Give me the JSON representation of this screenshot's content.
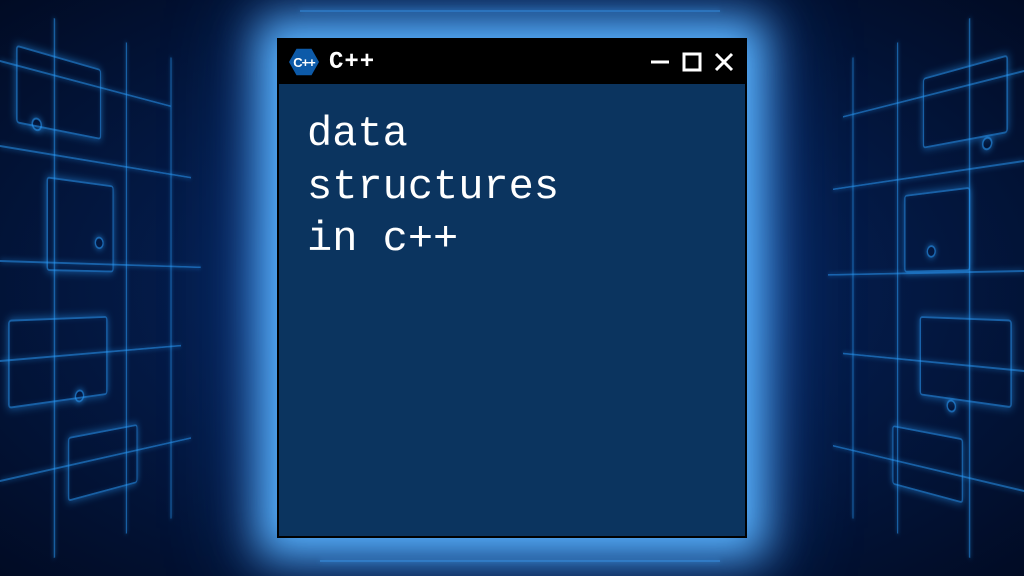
{
  "window": {
    "title": "C++",
    "logo_text": "C++"
  },
  "content": {
    "text": "data\nstructures\nin c++"
  }
}
